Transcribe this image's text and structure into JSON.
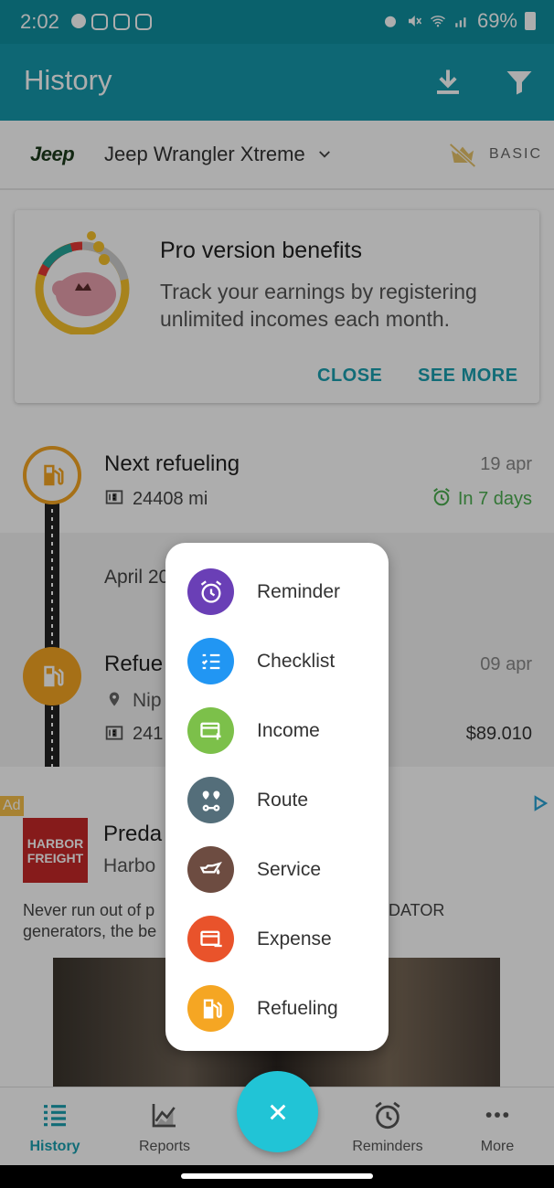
{
  "status_bar": {
    "time": "2:02",
    "battery": "69%"
  },
  "app_bar": {
    "title": "History",
    "actions": [
      "download-icon",
      "filter-icon"
    ]
  },
  "vehicle": {
    "brand_logo": "Jeep",
    "name": "Jeep Wrangler Xtreme",
    "plan": "BASIC"
  },
  "pro_card": {
    "title": "Pro version benefits",
    "description": "Track your earnings by registering unlimited incomes each month.",
    "close_label": "CLOSE",
    "see_more_label": "SEE MORE"
  },
  "next_refueling": {
    "title": "Next refueling",
    "odometer": "24408 mi",
    "date": "19 apr",
    "due_in": "In 7 days"
  },
  "month_header": "April 20",
  "refueling_entry": {
    "title": "Refue",
    "location": "Nip",
    "odometer": "241",
    "date": "09 apr",
    "cost": "$89.010"
  },
  "ad": {
    "tag": "Ad",
    "logo_text": "HARBOR FREIGHT",
    "headline": "Preda",
    "advertiser": "Harbo",
    "body_left_1": "Never run out of p",
    "body_right_1": "DATOR",
    "body_left_2": "generators, the be"
  },
  "fab_menu": {
    "items": [
      {
        "label": "Reminder",
        "icon": "alarm-clock-icon",
        "color": "#6a3fb6"
      },
      {
        "label": "Checklist",
        "icon": "checklist-icon",
        "color": "#2196f3"
      },
      {
        "label": "Income",
        "icon": "income-card-icon",
        "color": "#7cc04a"
      },
      {
        "label": "Route",
        "icon": "route-icon",
        "color": "#546e7a"
      },
      {
        "label": "Service",
        "icon": "oil-can-icon",
        "color": "#6d4c41"
      },
      {
        "label": "Expense",
        "icon": "expense-card-icon",
        "color": "#e9532b"
      },
      {
        "label": "Refueling",
        "icon": "fuel-pump-icon",
        "color": "#f5a623"
      }
    ]
  },
  "bottom_nav": {
    "items": [
      {
        "label": "History",
        "active": true
      },
      {
        "label": "Reports",
        "active": false
      },
      {
        "label": "Reminders",
        "active": false
      },
      {
        "label": "More",
        "active": false
      }
    ]
  },
  "colors": {
    "primary": "#1599ab",
    "accent": "#21c4d6",
    "fuel": "#f5a623",
    "positive": "#4caf50"
  }
}
